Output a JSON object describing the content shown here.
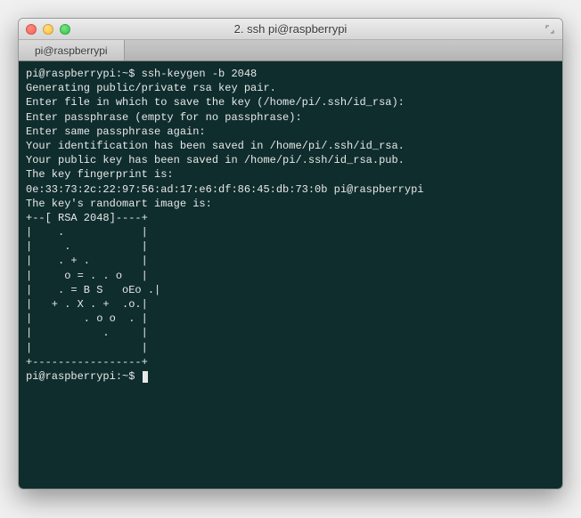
{
  "window": {
    "title": "2. ssh pi@raspberrypi"
  },
  "tabs": [
    {
      "label": "pi@raspberrypi"
    }
  ],
  "terminal": {
    "prompt": "pi@raspberrypi:~$ ",
    "command": "ssh-keygen -b 2048",
    "lines": {
      "l0": "Generating public/private rsa key pair.",
      "l1": "Enter file in which to save the key (/home/pi/.ssh/id_rsa):",
      "l2": "Enter passphrase (empty for no passphrase):",
      "l3": "Enter same passphrase again:",
      "l4": "Your identification has been saved in /home/pi/.ssh/id_rsa.",
      "l5": "Your public key has been saved in /home/pi/.ssh/id_rsa.pub.",
      "l6": "The key fingerprint is:",
      "l7": "0e:33:73:2c:22:97:56:ad:17:e6:df:86:45:db:73:0b pi@raspberrypi",
      "l8": "The key's randomart image is:",
      "r0": "+--[ RSA 2048]----+",
      "r1": "|    .            |",
      "r2": "|     .           |",
      "r3": "|    . + .        |",
      "r4": "|     o = . . o   |",
      "r5": "|    . = B S   oEo .|",
      "r6": "|   + . X . +  .o.|",
      "r7": "|        . o o  . |",
      "r8": "|           .     |",
      "r9": "|                 |",
      "r10": "+-----------------+"
    }
  }
}
